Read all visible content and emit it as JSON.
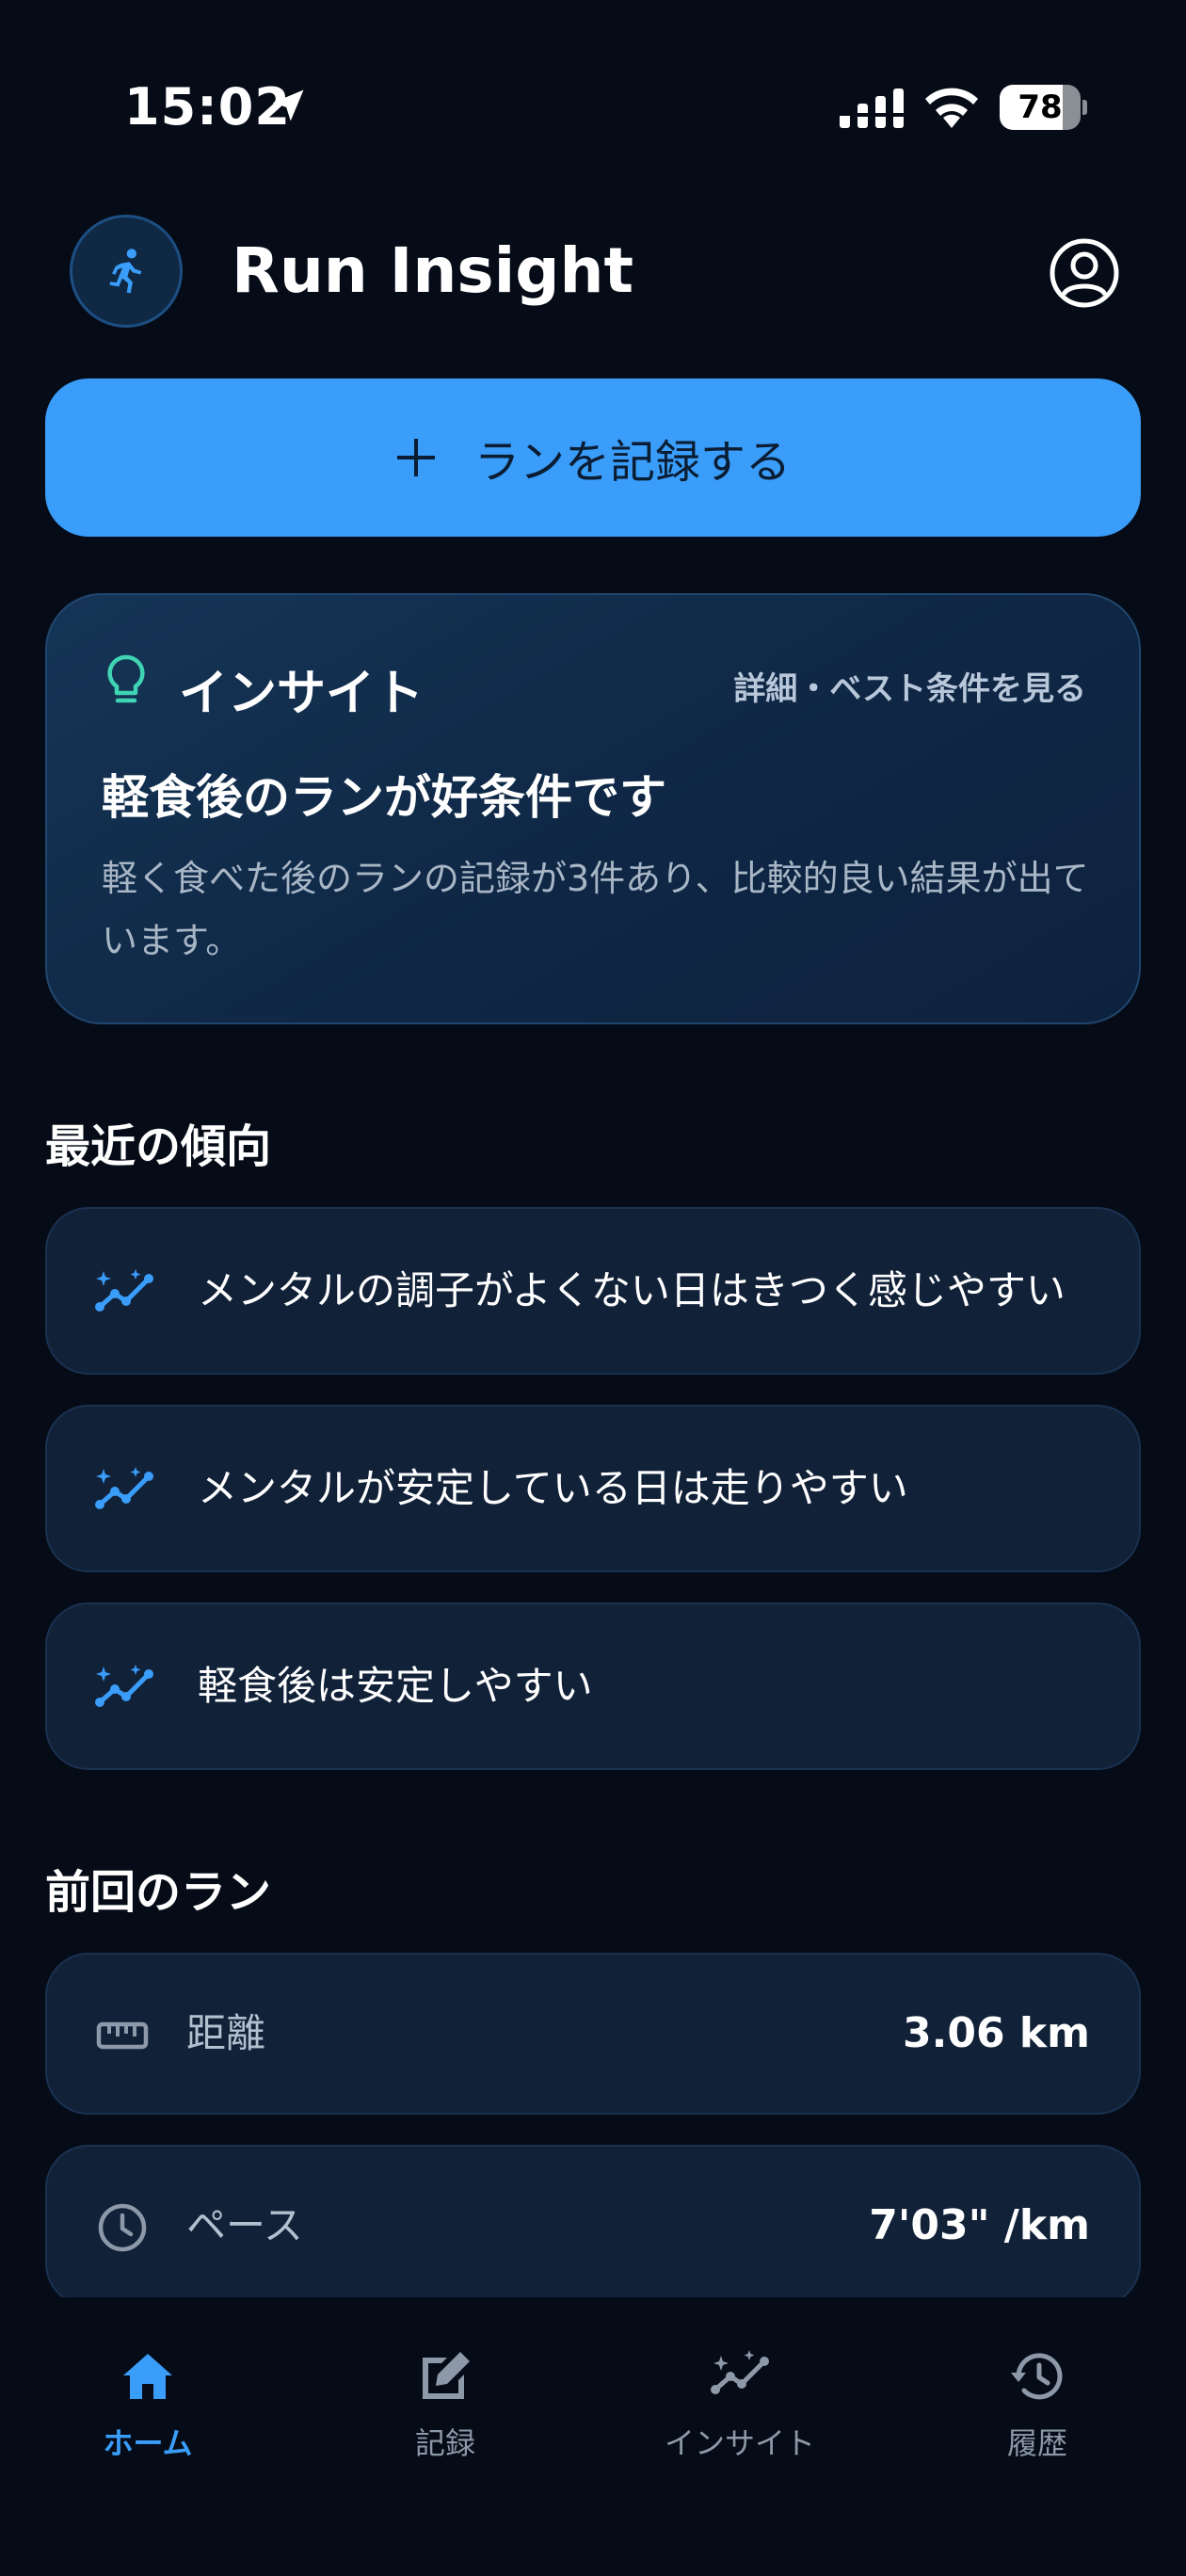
{
  "status_bar": {
    "time": "15:02",
    "battery_level": "78",
    "battery_fraction": 0.78
  },
  "header": {
    "title": "Run Insight",
    "logo_icon": "runner-icon",
    "profile_icon": "user-circle-icon"
  },
  "record_button": {
    "label": "ランを記録する",
    "icon": "plus-icon"
  },
  "insight": {
    "heading": "インサイト",
    "link": "詳細・ベスト条件を見る",
    "title": "軽食後のランが好条件です",
    "body": "軽く食べた後のランの記録が3件あり、比較的良い結果が出ています。"
  },
  "trends": {
    "title": "最近の傾向",
    "items": [
      {
        "text": "メンタルの調子がよくない日はきつく感じやすい"
      },
      {
        "text": "メンタルが安定している日は走りやすい"
      },
      {
        "text": "軽食後は安定しやすい"
      }
    ]
  },
  "last_run": {
    "title": "前回のラン",
    "stats": [
      {
        "label": "距離",
        "value": "3.06 km",
        "icon": "ruler-icon"
      },
      {
        "label": "ペース",
        "value": "7'03\" /km",
        "icon": "clock-icon"
      }
    ]
  },
  "nav": {
    "items": [
      {
        "label": "ホーム",
        "icon": "home-icon",
        "active": true
      },
      {
        "label": "記録",
        "icon": "edit-icon",
        "active": false
      },
      {
        "label": "インサイト",
        "icon": "insight-icon",
        "active": false
      },
      {
        "label": "履歴",
        "icon": "history-icon",
        "active": false
      }
    ]
  },
  "colors": {
    "accent": "#3a9dfa",
    "background": "#050c17",
    "card": "#112138",
    "bulb": "#3fd4b4"
  }
}
